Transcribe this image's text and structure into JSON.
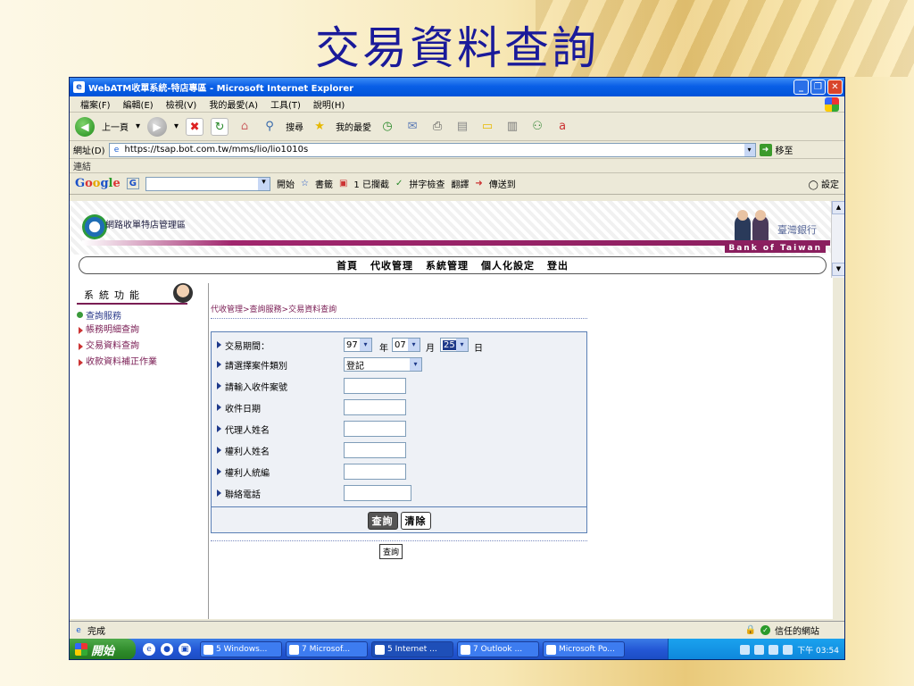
{
  "slide_title": "交易資料查詢",
  "window": {
    "title": "WebATM收單系統-特店專區 - Microsoft Internet Explorer",
    "buttons": [
      "_",
      "❐",
      "✕"
    ]
  },
  "menu": [
    "檔案(F)",
    "編輯(E)",
    "檢視(V)",
    "我的最愛(A)",
    "工具(T)",
    "說明(H)"
  ],
  "toolbar": {
    "back": "上一頁",
    "search": "搜尋",
    "favorites": "我的最愛"
  },
  "address": {
    "label": "網址(D)",
    "url": "https://tsap.bot.com.tw/mms/lio/lio1010s",
    "go": "移至"
  },
  "links_label": "連結",
  "google_bar": {
    "logo": [
      "G",
      "o",
      "o",
      "g",
      "l",
      "e"
    ],
    "search_prefix": "G",
    "start": "開始",
    "bookmarks": "書籤",
    "blocked": "1 已攔截",
    "spell": "拼字檢查",
    "translate": "翻譯",
    "send_to": "傳送到",
    "settings": "設定"
  },
  "bank": {
    "system_label": "網路收單特店管理區",
    "name_zh": "臺灣銀行",
    "name_en": "Bank of Taiwan"
  },
  "nav": [
    "首頁",
    "代收管理",
    "系統管理",
    "個人化設定",
    "登出"
  ],
  "sidebar": {
    "title": "系統功能",
    "section": "查詢服務",
    "items": [
      "帳務明細查詢",
      "交易資料查詢",
      "收款資料補正作業"
    ]
  },
  "breadcrumb": "代收管理>查詢服務>交易資料查詢",
  "form": {
    "period_label": "交易期間：",
    "year": "97",
    "year_unit": "年",
    "month": "07",
    "month_unit": "月",
    "day": "25",
    "day_unit": "日",
    "case_type_label": "請選擇案件類別",
    "case_type_value": "登記",
    "fields": [
      "請輸入收件案號",
      "收件日期",
      "代理人姓名",
      "權利人姓名",
      "權利人統編",
      "聯絡電話"
    ],
    "query_button": "查詢",
    "clear_button": "清除",
    "small_query_button": "查詢"
  },
  "status": {
    "text": "完成",
    "zone": "信任的網站"
  },
  "taskbar": {
    "start": "開始",
    "tasks": [
      "5 Windows...",
      "7 Microsof...",
      "5 Internet ...",
      "7 Outlook ...",
      "Microsoft Po..."
    ],
    "clock": "下午 03:54"
  }
}
